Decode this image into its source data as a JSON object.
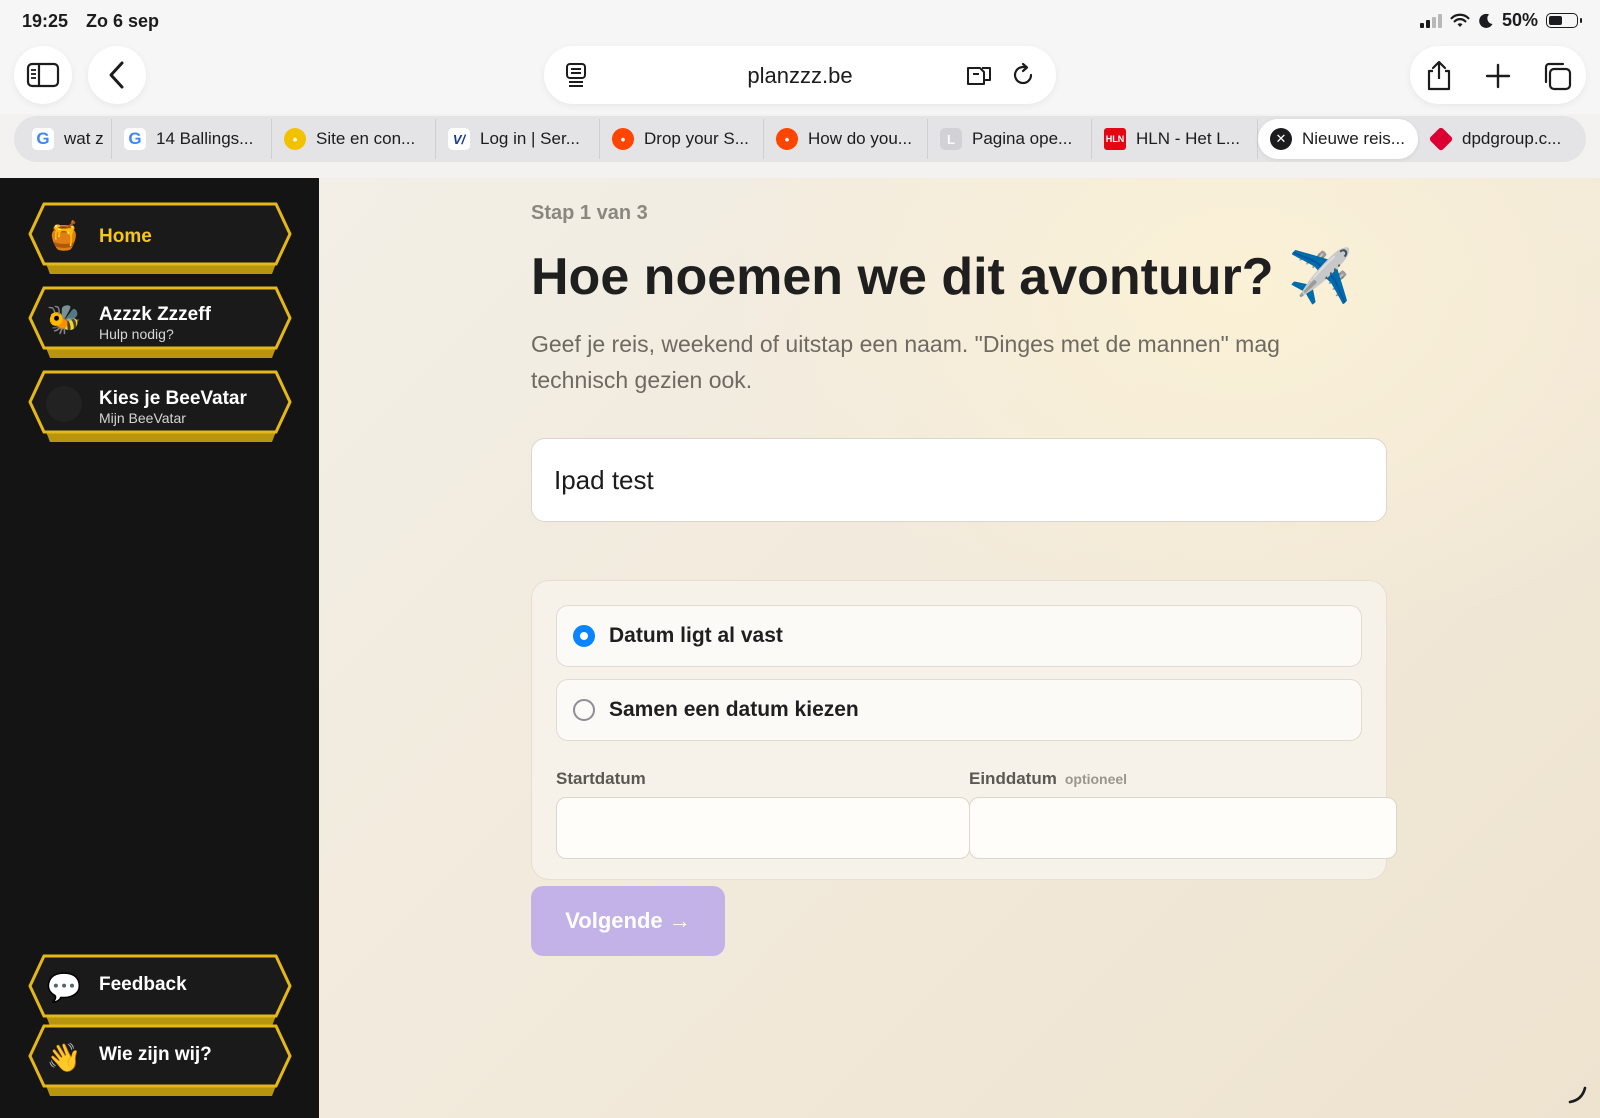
{
  "status_bar": {
    "time": "19:25",
    "date": "Zo 6 sep",
    "battery": "50%"
  },
  "toolbar": {
    "url": "planzzz.be"
  },
  "tabs": [
    {
      "label": "wat z",
      "favicon": "G",
      "favicon_color": "#4285f4"
    },
    {
      "label": "14 Ballings...",
      "favicon": "G",
      "favicon_color": "#4285f4"
    },
    {
      "label": "Site en con...",
      "favicon": "bee",
      "favicon_color": "#f2c200"
    },
    {
      "label": "Log in | Ser...",
      "favicon": "V",
      "favicon_color": "#1a3a8c"
    },
    {
      "label": "Drop your S...",
      "favicon": "reddit",
      "favicon_color": "#ff4500"
    },
    {
      "label": "How do you...",
      "favicon": "reddit",
      "favicon_color": "#ff4500"
    },
    {
      "label": "Pagina ope...",
      "favicon": "L",
      "favicon_color": "#c7c7cc"
    },
    {
      "label": "HLN - Het L...",
      "favicon": "HLN",
      "favicon_color": "#e30613"
    },
    {
      "label": "Nieuwe reis...",
      "favicon": "close",
      "favicon_color": "#1c1c1e",
      "active": true
    },
    {
      "label": "dpdgroup.c...",
      "favicon": "dpd",
      "favicon_color": "#dc0032"
    }
  ],
  "sidebar": {
    "home": {
      "label": "Home",
      "emoji": "🍯"
    },
    "assistant": {
      "label": "Azzzk Zzzeff",
      "sub": "Hulp nodig?",
      "emoji": "🐝"
    },
    "beevatar": {
      "label": "Kies je BeeVatar",
      "sub": "Mijn BeeVatar"
    },
    "feedback": {
      "label": "Feedback",
      "emoji": "💬"
    },
    "about": {
      "label": "Wie zijn wij?",
      "emoji": "👋"
    }
  },
  "main": {
    "step": "Stap 1 van 3",
    "title": "Hoe noemen we dit avontuur? ✈️",
    "lead": "Geef je reis, weekend of uitstap een naam. \"Dinges met de mannen\" mag technisch gezien ook.",
    "name_value": "Ipad test",
    "radio_fixed": "Datum ligt al vast",
    "radio_together": "Samen een datum kiezen",
    "start_label": "Startdatum",
    "end_label": "Einddatum",
    "end_optional": "optioneel",
    "next_button": "Volgende →"
  }
}
